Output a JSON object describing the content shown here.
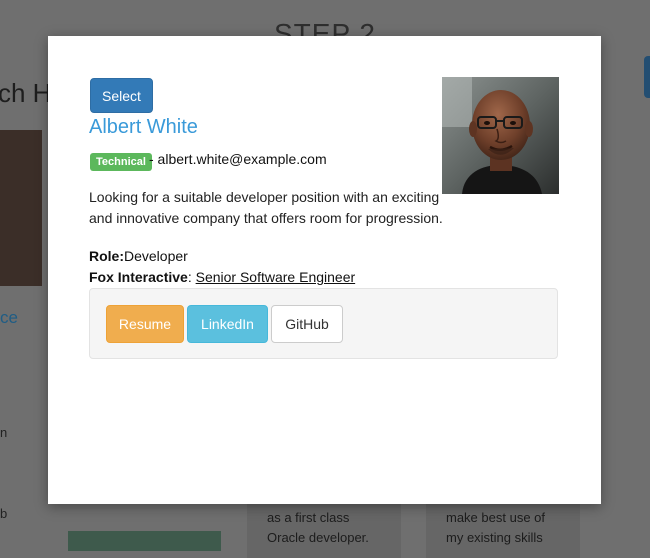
{
  "background": {
    "step_title": "STEP 2",
    "heading_fragment": "ch H",
    "link_fragment": "ce",
    "side_fragment_1": "n",
    "side_fragment_2": "b",
    "card_middle_lines": [
      "as a first class",
      "Oracle developer."
    ],
    "card_right_lines": [
      "make best use of",
      "my existing skills"
    ]
  },
  "modal": {
    "select_label": "Select",
    "name": "Albert White",
    "badge": "Technical",
    "email_line": "- albert.white@example.com",
    "bio_line1": "Looking for a suitable developer position with an exciting",
    "bio_line2": "and innovative company that offers room for progression.",
    "role_label": "Role:",
    "role_value": "Developer",
    "company_name": "Fox Interactive",
    "company_sep": ": ",
    "position": "Senior Software Engineer",
    "buttons": {
      "resume": "Resume",
      "linkedin": "LinkedIn",
      "github": "GitHub"
    }
  },
  "colors": {
    "primary": "#337ab7",
    "name_link": "#3a9ad9",
    "badge_success": "#5cb85c",
    "warning": "#f0ad4e",
    "info": "#5bc0de"
  }
}
